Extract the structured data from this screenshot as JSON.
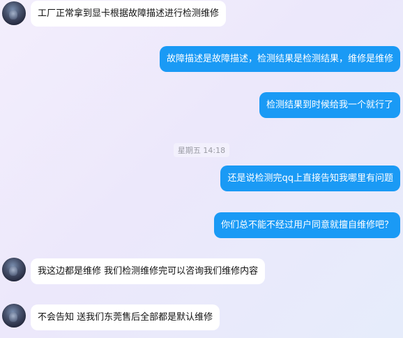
{
  "messages": [
    {
      "side": "left",
      "text": "工厂正常拿到显卡根据故障描述进行检测维修"
    },
    {
      "side": "right",
      "text": "故障描述是故障描述，检测结果是检测结果，维修是维修"
    },
    {
      "side": "right",
      "text": "检测结果到时候给我一个就行了"
    },
    {
      "side": "right",
      "text": "还是说检测完qq上直接告知我哪里有问题"
    },
    {
      "side": "right",
      "text": "你们总不能不经过用户同意就擅自维修吧？"
    },
    {
      "side": "left",
      "text": "我这边都是维修  我们检测维修完可以咨询我们维修内容"
    },
    {
      "side": "left",
      "text": "不会告知  送我们东莞售后全部都是默认维修"
    }
  ],
  "timestamp": "星期五 14:18",
  "colors": {
    "outgoing_bubble": "#1a9af5",
    "incoming_bubble": "#ffffff",
    "timestamp_text": "#999aa3"
  }
}
